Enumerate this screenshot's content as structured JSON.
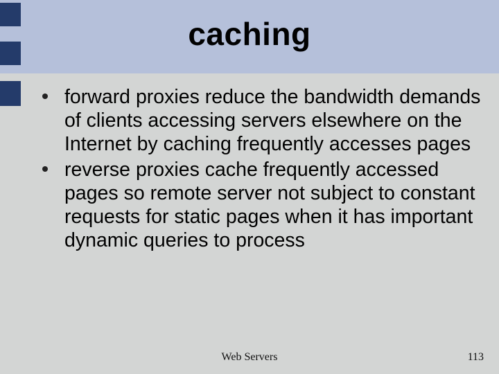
{
  "slide": {
    "title": "caching",
    "bullets": [
      "forward proxies reduce the bandwidth demands of clients accessing servers elsewhere on the Internet by caching frequently accesses pages",
      "reverse proxies cache frequently accessed pages so remote server not subject to constant requests for static pages when it has important dynamic queries to process"
    ],
    "footer_center": "Web Servers",
    "page_number": "113"
  }
}
